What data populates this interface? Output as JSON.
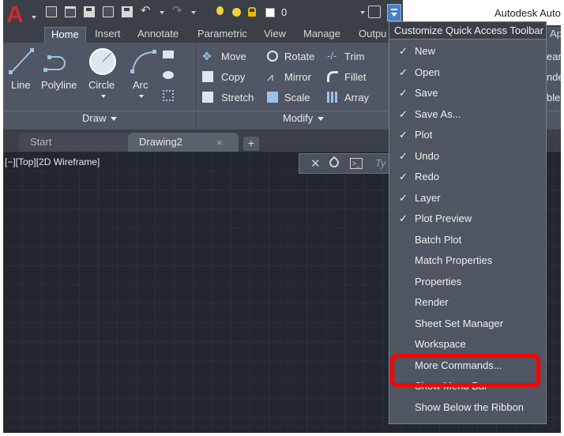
{
  "app": {
    "title": "Autodesk Auto",
    "logo_letter": "A"
  },
  "qat": {
    "layer_value": "0",
    "icons": [
      "new-icon",
      "open-icon",
      "save-icon",
      "save-as-icon",
      "plot-icon",
      "undo-icon",
      "redo-icon",
      "lightbulb-icon",
      "sun-icon",
      "lock-icon",
      "color-swatch-icon"
    ]
  },
  "ribbon_tabs": [
    {
      "label": "Home",
      "active": true
    },
    {
      "label": "Insert"
    },
    {
      "label": "Annotate"
    },
    {
      "label": "Parametric"
    },
    {
      "label": "View"
    },
    {
      "label": "Manage"
    },
    {
      "label": "Outpu"
    }
  ],
  "right_cutoff_tab": "Ap",
  "draw_panel": {
    "title": "Draw",
    "buttons": [
      "Line",
      "Polyline",
      "Circle",
      "Arc"
    ]
  },
  "modify_panel": {
    "title": "Modify",
    "buttons": [
      [
        "Move",
        "Rotate",
        "Trim"
      ],
      [
        "Copy",
        "Mirror",
        "Fillet"
      ],
      [
        "Stretch",
        "Scale",
        "Array"
      ]
    ]
  },
  "right_cutoff_labels": [
    "ear",
    "nde",
    "ble"
  ],
  "file_tabs": {
    "start": "Start",
    "drawing": "Drawing2",
    "close_glyph": "×",
    "new_glyph": "+"
  },
  "viewport": {
    "controls": "[−][Top][2D Wireframe]"
  },
  "command_line": {
    "placeholder": "Ty"
  },
  "menu": {
    "header": "Customize Quick Access Toolbar",
    "items": [
      {
        "label": "New",
        "checked": true
      },
      {
        "label": "Open",
        "checked": true
      },
      {
        "label": "Save",
        "checked": true
      },
      {
        "label": "Save As...",
        "checked": true
      },
      {
        "label": "Plot",
        "checked": true
      },
      {
        "label": "Undo",
        "checked": true
      },
      {
        "label": "Redo",
        "checked": true
      },
      {
        "label": "Layer",
        "checked": true
      },
      {
        "label": "Plot Preview",
        "checked": true
      },
      {
        "label": "Batch Plot",
        "checked": false
      },
      {
        "label": "Match Properties",
        "checked": false
      },
      {
        "label": "Properties",
        "checked": false
      },
      {
        "label": "Render",
        "checked": false
      },
      {
        "label": "Sheet Set Manager",
        "checked": false
      },
      {
        "label": "Workspace",
        "checked": false
      },
      {
        "label": "More Commands...",
        "checked": false
      },
      {
        "label": "Show Menu Bar",
        "checked": false
      },
      {
        "label": "Show Below the Ribbon",
        "checked": false
      }
    ],
    "check_glyph": "✓"
  },
  "colors": {
    "accent_highlight": "#ff0000",
    "brand_red": "#d12b2b",
    "customize_button": "#4a7fc1"
  }
}
